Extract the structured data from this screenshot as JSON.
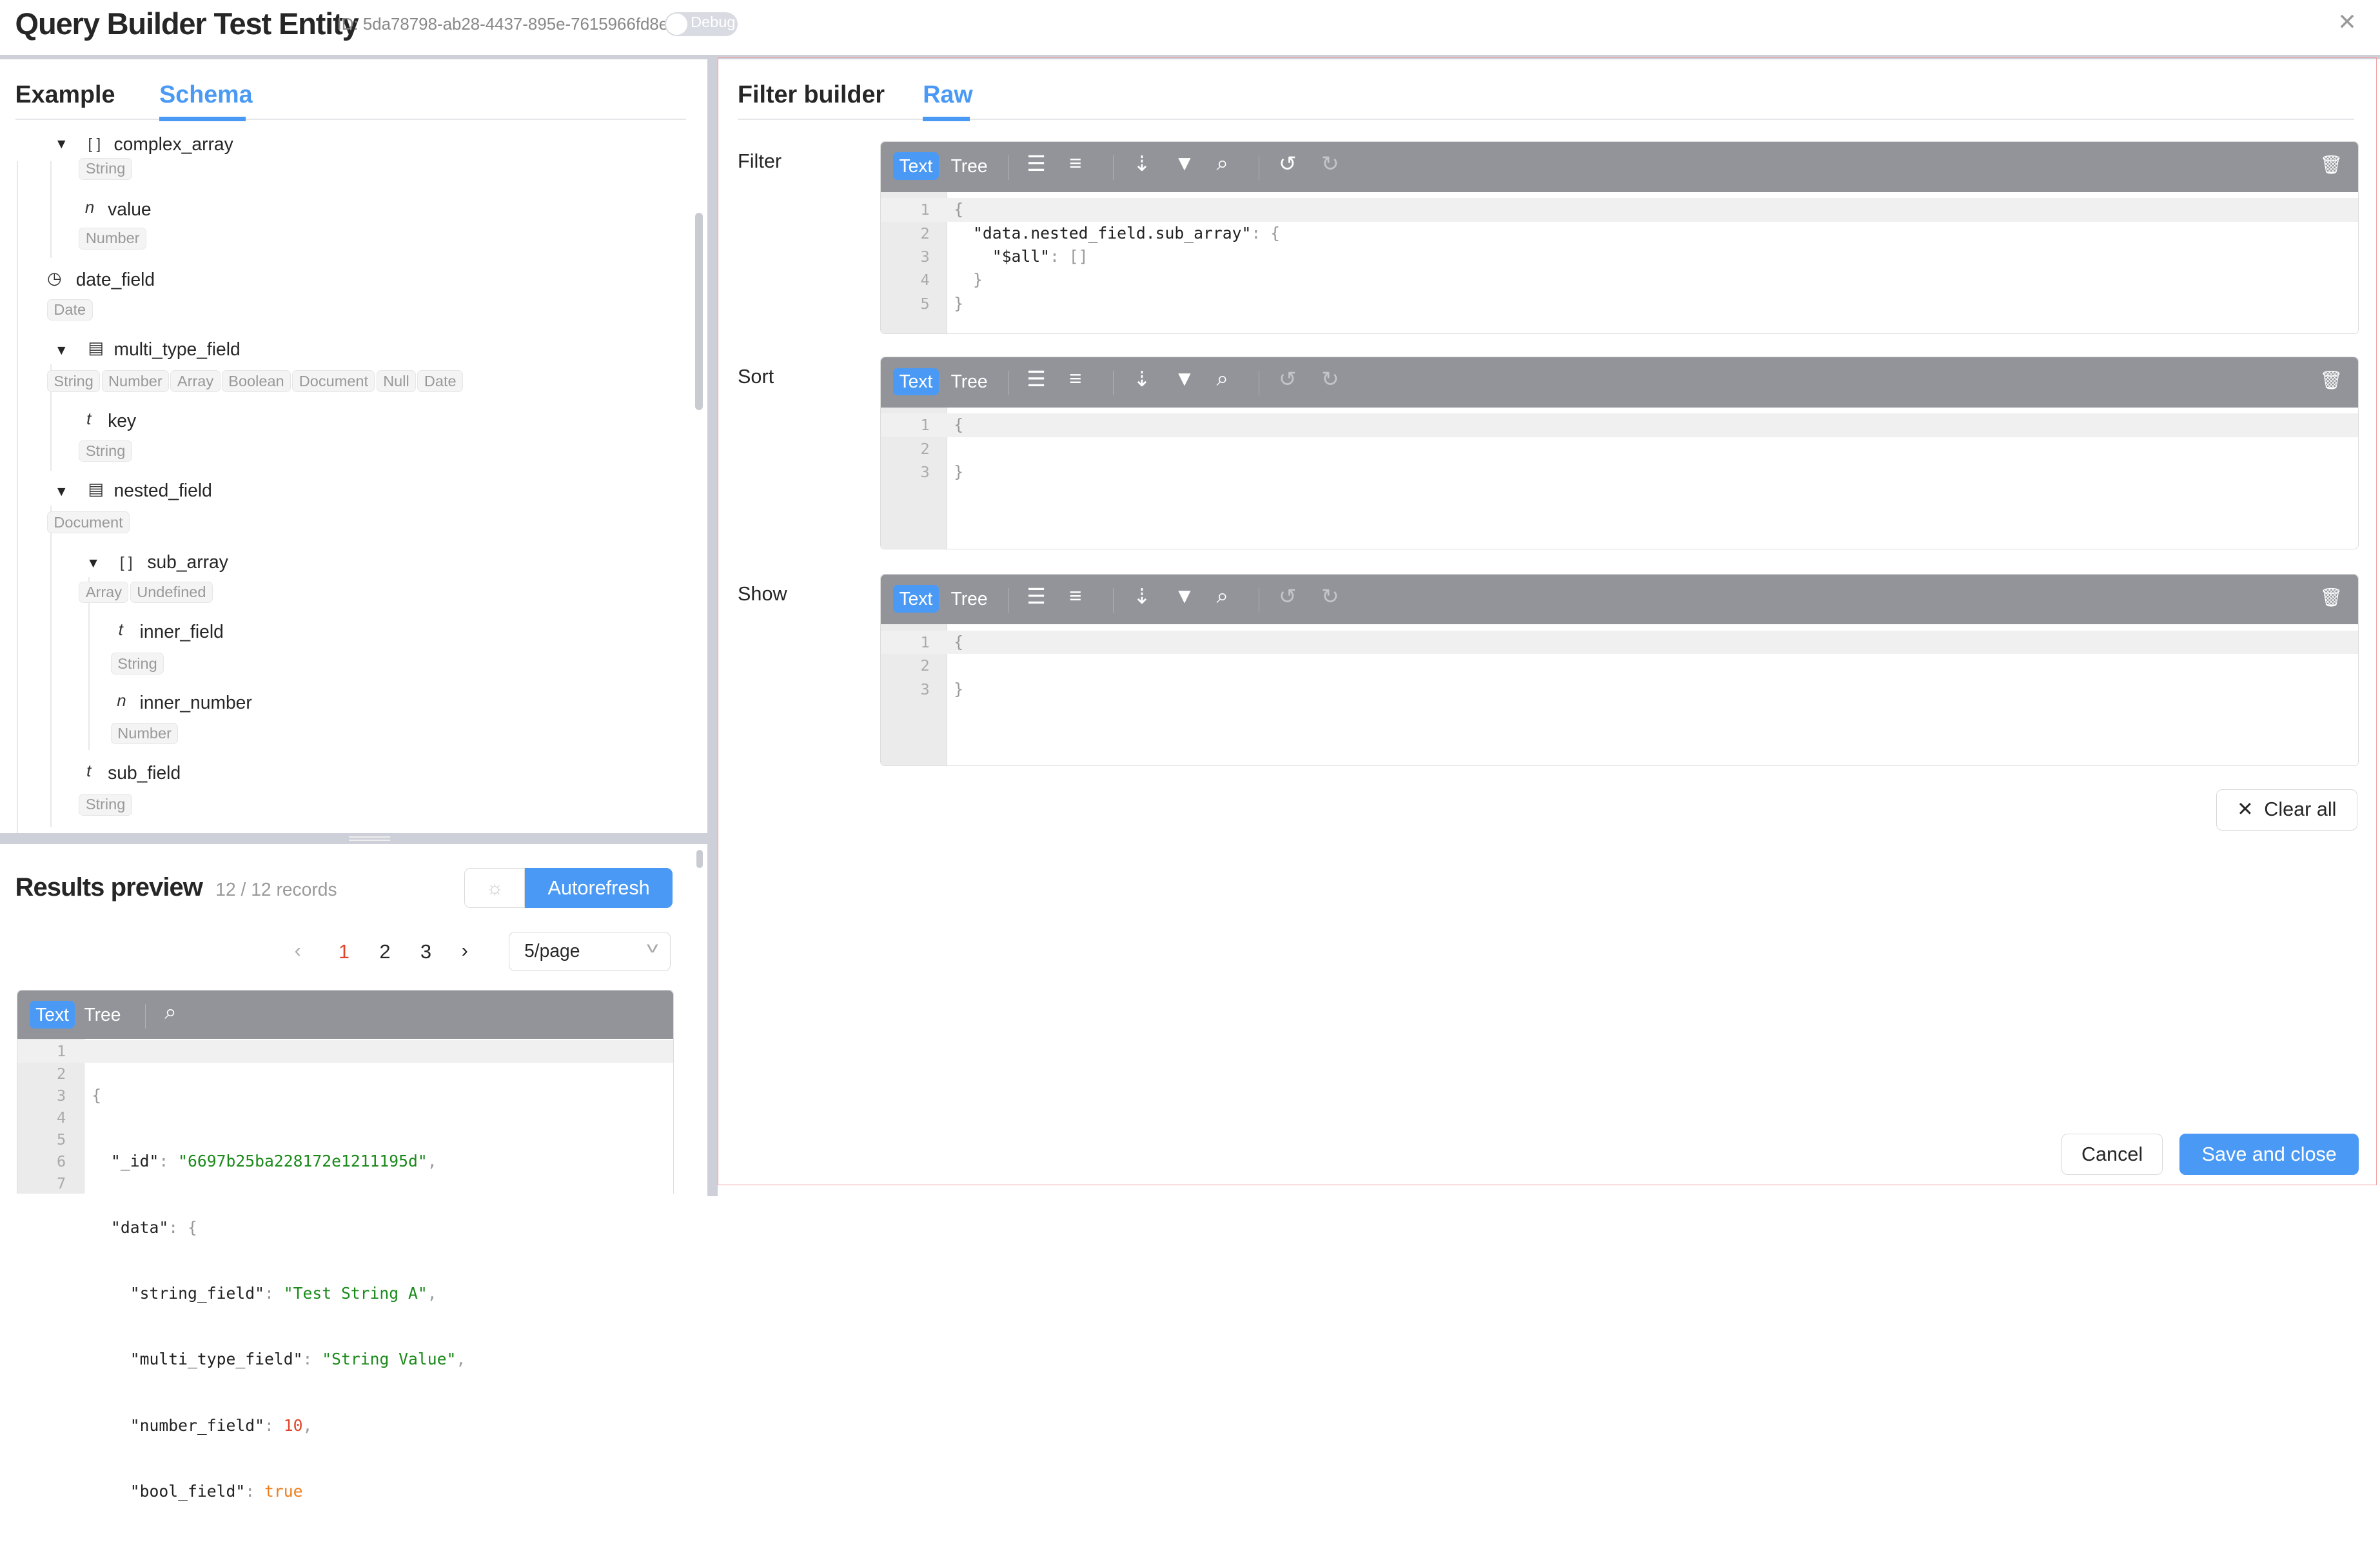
{
  "header": {
    "title": "Query Builder Test Entity",
    "id_text": "ID: 5da78798-ab28-4437-895e-7615966fd8e1",
    "debug_label": "Debug",
    "debug_on": false,
    "close_icon": "close-icon"
  },
  "left": {
    "tabs": [
      {
        "label": "Example",
        "active": false
      },
      {
        "label": "Schema",
        "active": true
      }
    ],
    "tree": [
      {
        "label": "complex_array",
        "icon": "[]",
        "caret": true,
        "tags": [
          "String"
        ]
      },
      {
        "label": "value",
        "icon": "n",
        "tags": [
          "Number"
        ]
      },
      {
        "label": "date_field",
        "icon": "clock",
        "tags": [
          "Date"
        ]
      },
      {
        "label": "multi_type_field",
        "icon": "table",
        "caret": true,
        "tags": [
          "String",
          "Number",
          "Array",
          "Boolean",
          "Document",
          "Null",
          "Date"
        ]
      },
      {
        "label": "key",
        "icon": "t",
        "tags": [
          "String"
        ]
      },
      {
        "label": "nested_field",
        "icon": "table",
        "caret": true,
        "tags": [
          "Document"
        ]
      },
      {
        "label": "sub_array",
        "icon": "[]",
        "caret": true,
        "tags": [
          "Array",
          "Undefined"
        ]
      },
      {
        "label": "inner_field",
        "icon": "t",
        "tags": [
          "String"
        ]
      },
      {
        "label": "inner_number",
        "icon": "n",
        "tags": [
          "Number"
        ]
      },
      {
        "label": "sub_field",
        "icon": "t",
        "tags": [
          "String"
        ]
      }
    ],
    "results": {
      "title": "Results preview",
      "count": "12 / 12 records",
      "autorefresh_label": "Autorefresh",
      "pages": [
        "1",
        "2",
        "3"
      ],
      "current_page": "1",
      "page_size": "5/page",
      "editor_tabs": [
        "Text",
        "Tree"
      ],
      "lines": [
        "1",
        "2",
        "3",
        "4",
        "5",
        "6",
        "7"
      ]
    }
  },
  "right": {
    "tabs": [
      {
        "label": "Filter builder",
        "active": false
      },
      {
        "label": "Raw",
        "active": true
      }
    ],
    "editor_tabs": [
      "Text",
      "Tree"
    ],
    "sections": [
      {
        "label": "Filter",
        "lines": [
          "1",
          "2",
          "3",
          "4",
          "5"
        ]
      },
      {
        "label": "Sort",
        "lines": [
          "1",
          "2",
          "3"
        ]
      },
      {
        "label": "Show",
        "lines": [
          "1",
          "2",
          "3"
        ]
      }
    ],
    "clear_all": "Clear all",
    "cancel": "Cancel",
    "save": "Save and close"
  },
  "code": {
    "filter": {
      "l1": "{",
      "l2k": "\"data.nested_field.sub_array\"",
      "l2p": ": {",
      "l3k": "\"$all\"",
      "l3p": ": []",
      "l4": "}",
      "l5": "}"
    },
    "empty": {
      "open": "{",
      "close": "}"
    },
    "result": {
      "l1": "{",
      "l2k": "\"_id\"",
      "l2v": "\"6697b25ba228172e1211195d\"",
      "l3k": "\"data\"",
      "l3p": ": {",
      "l4k": "\"string_field\"",
      "l4v": "\"Test String A\"",
      "l5k": "\"multi_type_field\"",
      "l5v": "\"String Value\"",
      "l6k": "\"number_field\"",
      "l6v": "10",
      "l7k": "\"bool_field\"",
      "l7v": "true"
    }
  },
  "colors": {
    "accent": "#4a9af5",
    "toolbar": "#929499",
    "active_page": "#e0452b",
    "string": "#1a8a1a",
    "number": "#e0452b",
    "boolean": "#ee7d1b"
  }
}
